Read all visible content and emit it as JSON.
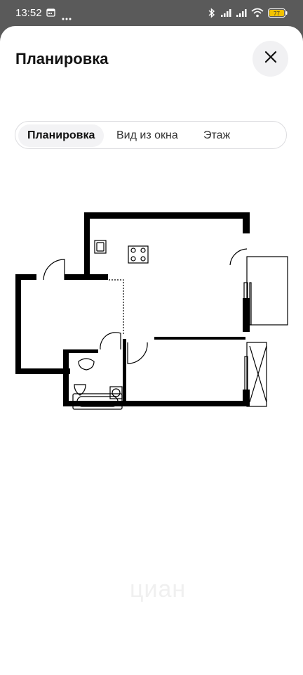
{
  "status_bar": {
    "time": "13:52",
    "battery": "77",
    "icons": [
      "calendar-icon",
      "more-icon",
      "bluetooth-icon",
      "signal-icon",
      "signal-icon",
      "wifi-icon",
      "battery-icon"
    ]
  },
  "header": {
    "title": "Планировка",
    "close_icon": "close-icon"
  },
  "tabs": [
    {
      "label": "Планировка",
      "active": true
    },
    {
      "label": "Вид из окна",
      "active": false
    },
    {
      "label": "Этаж",
      "active": false
    }
  ],
  "watermark": "циан",
  "nav_bar": {
    "icons": [
      "recents-icon",
      "home-icon",
      "back-icon"
    ]
  },
  "colors": {
    "sheet_bg": "#ffffff",
    "backdrop": "#5a5a5a",
    "wall": "#000000",
    "tab_active_bg": "#f3f3f5",
    "close_bg": "#f1f1f3",
    "battery": "#f2c200"
  }
}
